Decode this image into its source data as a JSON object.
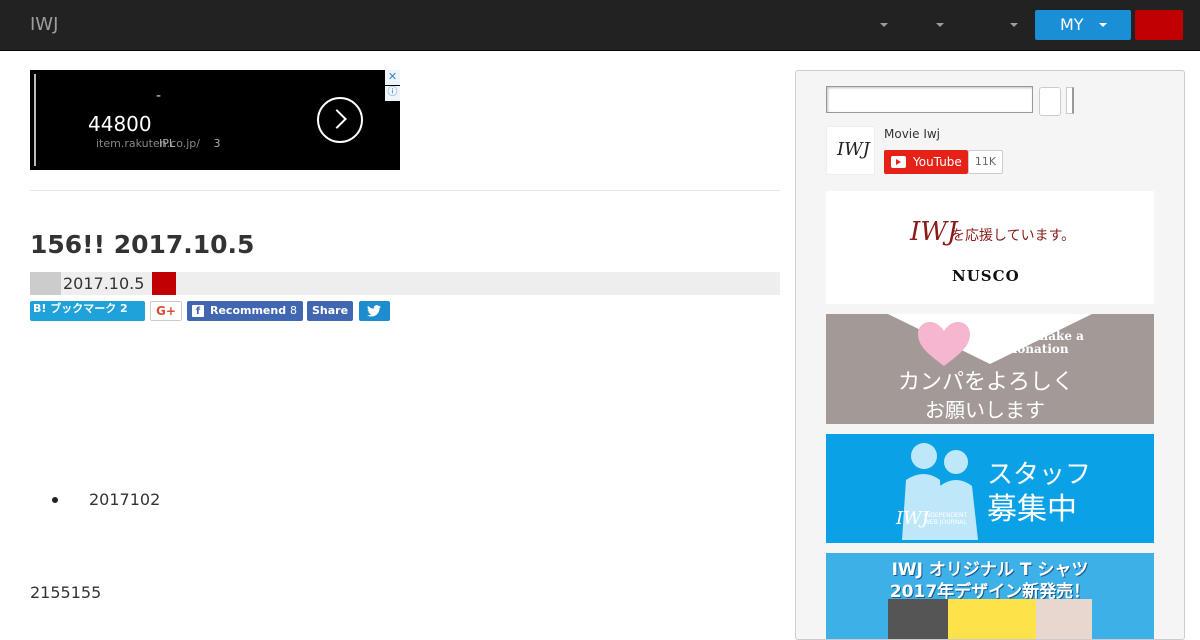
{
  "nav": {
    "brand": "IWJ",
    "my_label": "MY"
  },
  "ad": {
    "dash": "-",
    "price": "44800",
    "url": "item.rakuten.co.jp/",
    "url_overlay": "IPL",
    "count": "3",
    "close_glyph": "✕",
    "info_glyph": "ⓘ"
  },
  "article": {
    "title": "156!! 2017.10.5",
    "date": "2017.10.5",
    "list_item": "2017102",
    "body": "2155155"
  },
  "social": {
    "hatena_label": "B! ブックマーク 2",
    "gplus_label": "G+",
    "fb_label": "Recommend",
    "fb_count": "8",
    "share_label": "Share"
  },
  "sidebar": {
    "search_value": "",
    "channel_name": "Movie Iwj",
    "youtube_label": "YouTube",
    "youtube_count": "11K",
    "banners": {
      "sponsor_logo": "IWJ",
      "sponsor_text": "を応援しています。",
      "sponsor_name": "NUSCO",
      "donate_en_1": "Please make a",
      "donate_en_2": "donation",
      "donate_jp_1": "カンパをよろしく",
      "donate_jp_2": "お願いします",
      "staff_jp_1": "スタッフ",
      "staff_jp_2": "募集中",
      "staff_logo": "IWJ",
      "staff_sub_1": "INDEPENDENT",
      "staff_sub_2": "WEB JOURNAL",
      "tshirt_1": "IWJ オリジナル T シャツ",
      "tshirt_2": "2017年デザイン新発売！"
    }
  },
  "colors": {
    "navbar": "#222222",
    "my_button": "#1a8fd6",
    "red_accent": "#c00000",
    "youtube_red": "#e62117",
    "facebook": "#4267b2",
    "twitter": "#1d8dcf",
    "hatena": "#1fa2d9"
  }
}
